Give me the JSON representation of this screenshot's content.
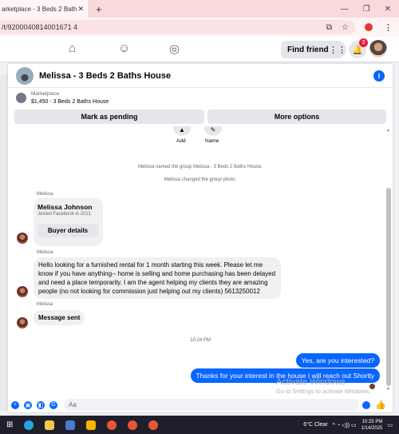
{
  "browser": {
    "tab_title": "arketplace - 3 Beds 2 Bath",
    "tab_close": "✕",
    "new_tab": "+",
    "url": "/t/9200040814001671 4",
    "window_controls": [
      "—",
      "❐",
      "✕"
    ]
  },
  "fb_header": {
    "find_friends": "Find friends",
    "notification_count": "3"
  },
  "chat": {
    "title": "Melissa - 3 Beds 2 Baths House",
    "info": "i",
    "listing": {
      "label": "Marketplace",
      "value": "$1,450 - 3 Beds 2 Baths House"
    },
    "mark_pending": "Mark as pending",
    "more_options": "More options",
    "actions": {
      "add": "Add",
      "name": "Name"
    },
    "system_messages": [
      "Melissa named the group Melissa - 3 Beds 2 Baths House.",
      "Melissa changed the group photo."
    ],
    "sender_name": "Melissa",
    "profile_card": {
      "name": "Melissa Johnson",
      "subtitle": "Joined Facebook in 2021",
      "button": "Buyer details"
    },
    "incoming_message": "Hello looking for a furnished rental for 1 month starting this week. Please let me know if you have anything-- home is selling and home purchasing has been delayed and need a place temporarily. I am the agent helping my clients they are amazing people (no not looking for commission just helping out my clients) 5613250012",
    "incoming_message_2": "Message sent",
    "timestamp": "10:24 PM",
    "outgoing_1": "Yes, are you interested?",
    "outgoing_2": "Thanks for your interest in the house I will reach out Shortly",
    "composer_placeholder": "Aa"
  },
  "watermark": {
    "title": "Activate Windows",
    "subtitle": "Go to Settings to activate Windows."
  },
  "taskbar": {
    "weather": "6°C  Clear",
    "time": "10:25 PM",
    "date": "1/14/2025"
  },
  "colors": {
    "accent": "#0866ff",
    "taskbar": "#1f1f2c",
    "titlebar": "#f9d9dc"
  }
}
